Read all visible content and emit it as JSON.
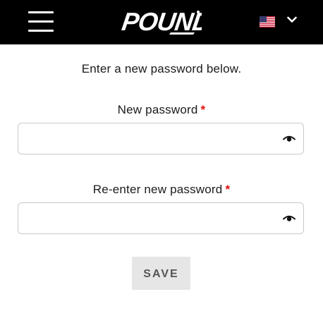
{
  "header": {
    "logo_text": "POUND",
    "menu_icon": "hamburger-menu-icon",
    "language_flag": "us-flag-icon",
    "language_chevron": "chevron-down-icon"
  },
  "form": {
    "intro": "Enter a new password below.",
    "new_password": {
      "label": "New password",
      "required_mark": "*",
      "value": "",
      "toggle_icon": "eye-icon"
    },
    "confirm_password": {
      "label": "Re-enter new password",
      "required_mark": "*",
      "value": "",
      "toggle_icon": "eye-icon"
    },
    "save_label": "SAVE"
  },
  "colors": {
    "header_bg": "#000000",
    "required": "#e01010",
    "button_bg": "#e6e6e6",
    "button_text": "#555555"
  }
}
